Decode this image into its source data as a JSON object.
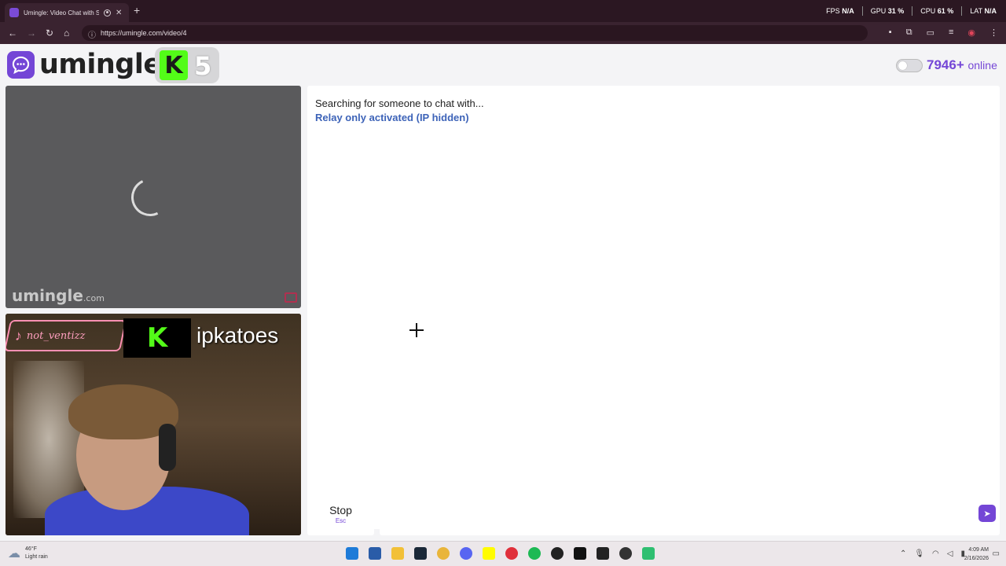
{
  "browser": {
    "tab_title": "Umingle: Video Chat with S",
    "url": "https://umingle.com/video/4",
    "perf": {
      "fps_label": "FPS",
      "fps_value": "N/A",
      "gpu_label": "GPU",
      "gpu_value": "31 %",
      "cpu_label": "CPU",
      "cpu_value": "61 %",
      "lat_label": "LAT",
      "lat_value": "N/A"
    }
  },
  "site": {
    "logo_text": "umingle",
    "kick_badge_letter": "K",
    "kick_badge_number": "5",
    "online_count": "7946+",
    "online_label": "online"
  },
  "remote_video": {
    "watermark": "umingle",
    "watermark_suffix": ".com"
  },
  "local_video": {
    "tiktok_handle": "not_ventizz",
    "kick_letter": "K",
    "kick_username": "ipkatoes"
  },
  "chat": {
    "status": "Searching for someone to chat with...",
    "relay": "Relay only activated (IP hidden)",
    "stop_label": "Stop",
    "stop_hint": "Esc",
    "input_value": ""
  },
  "taskbar": {
    "weather_temp": "46°F",
    "weather_desc": "Light rain",
    "time": "4:09 AM",
    "date": "2/16/2026"
  },
  "colors": {
    "brand": "#7446d6",
    "kick_green": "#53fc18",
    "relay_blue": "#3d63b8"
  }
}
